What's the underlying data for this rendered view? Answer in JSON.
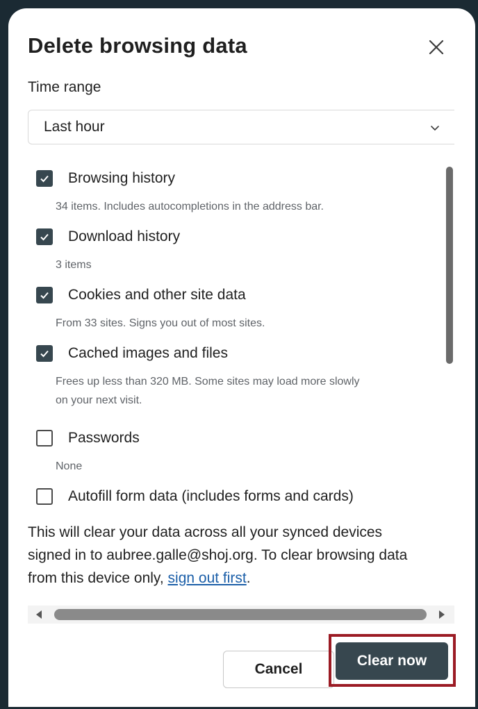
{
  "dialog": {
    "title": "Delete browsing data",
    "close_icon": "close-icon"
  },
  "time_range": {
    "label": "Time range",
    "selected": "Last hour"
  },
  "options": [
    {
      "label": "Browsing history",
      "checked": true,
      "description": "34 items. Includes autocompletions in the address bar."
    },
    {
      "label": "Download history",
      "checked": true,
      "description": "3 items"
    },
    {
      "label": "Cookies and other site data",
      "checked": true,
      "description": "From 33 sites. Signs you out of most sites."
    },
    {
      "label": "Cached images and files",
      "checked": true,
      "description_line1": "Frees up less than 320 MB. Some sites may load more slowly",
      "description_line2": "on your next visit."
    },
    {
      "label": "Passwords",
      "checked": false,
      "description": "None"
    },
    {
      "label": "Autofill form data (includes forms and cards)",
      "checked": false
    }
  ],
  "sync_note": {
    "line1": "This will clear your data across all your synced devices",
    "line2": "signed in to aubree.galle@shoj.org. To clear browsing data",
    "line3_prefix": "from this device only, ",
    "link": "sign out first",
    "line3_suffix": "."
  },
  "buttons": {
    "cancel": "Cancel",
    "clear": "Clear now"
  },
  "colors": {
    "accent": "#37474f",
    "highlight": "#9b1b24",
    "link": "#1a5ea8"
  }
}
